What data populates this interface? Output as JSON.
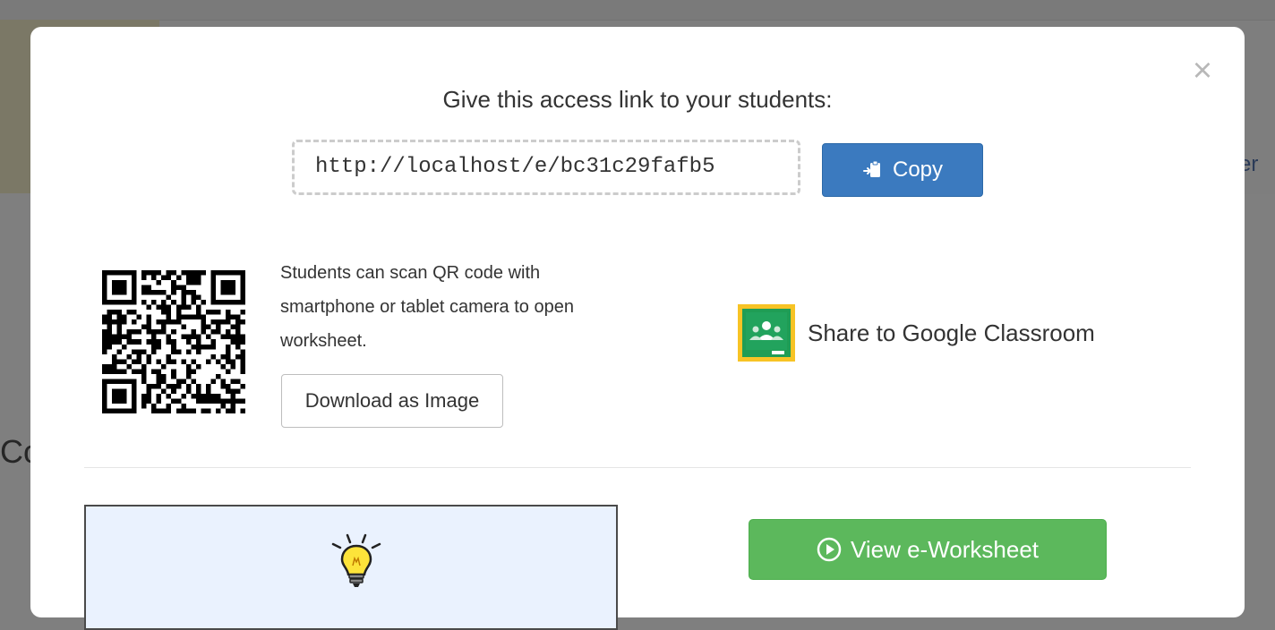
{
  "background": {
    "right_fragment": "er",
    "left_fragment": "Co"
  },
  "modal": {
    "heading": "Give this access link to your students:",
    "access_link": "http://localhost/e/bc31c29fafb5",
    "copy_label": "Copy",
    "qr_text": "Students can scan QR code with smartphone or tablet camera to open worksheet.",
    "download_label": "Download as Image",
    "google_classroom_label": "Share to Google Classroom",
    "view_label": "View e-Worksheet"
  },
  "icons": {
    "close": "close-icon",
    "copy": "clipboard-icon",
    "google_classroom": "google-classroom-icon",
    "view": "play-circle-icon",
    "preview": "lightbulb-icon"
  },
  "colors": {
    "copy_button": "#3b7abf",
    "view_button": "#5cb85c",
    "classroom_green": "#1f9d55",
    "classroom_yellow": "#f7c325"
  }
}
